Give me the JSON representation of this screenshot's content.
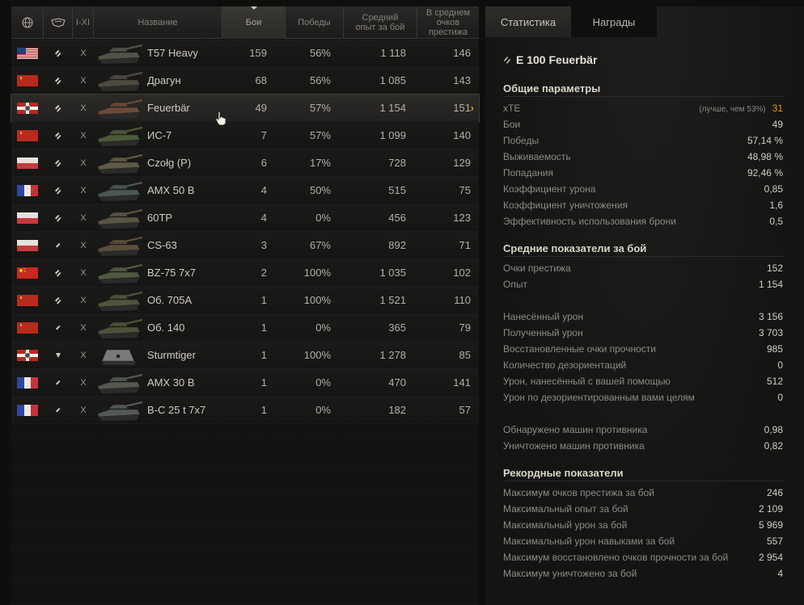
{
  "table": {
    "headers": {
      "nation_icon": "globe-icon",
      "type_icon": "tank-type-icon",
      "tier": "I-XI",
      "name": "Название",
      "battles": "Бои",
      "wins": "Победы",
      "avg_xp": "Средний опыт за бой",
      "avg_prestige": "В среднем очков престижа"
    },
    "rows": [
      {
        "flag": "usa",
        "type": "heavy",
        "tier": "X",
        "name": "T57 Heavy",
        "battles": "159",
        "wins": "56%",
        "xp": "1 118",
        "prestige": "146",
        "color": "#505447"
      },
      {
        "flag": "ussr",
        "type": "heavy",
        "tier": "X",
        "name": "Драгун",
        "battles": "68",
        "wins": "56%",
        "xp": "1 085",
        "prestige": "143",
        "color": "#4f4a40"
      },
      {
        "flag": "germany",
        "type": "heavy",
        "tier": "X",
        "name": "Feuerbär",
        "battles": "49",
        "wins": "57%",
        "xp": "1 154",
        "prestige": "151",
        "color": "#6b4a35",
        "selected": true
      },
      {
        "flag": "ussr",
        "type": "heavy",
        "tier": "X",
        "name": "ИС-7",
        "battles": "7",
        "wins": "57%",
        "xp": "1 099",
        "prestige": "140",
        "color": "#4d5a3a"
      },
      {
        "flag": "poland",
        "type": "heavy",
        "tier": "X",
        "name": "Czołg (P)",
        "battles": "6",
        "wins": "17%",
        "xp": "728",
        "prestige": "129",
        "color": "#5e5a44"
      },
      {
        "flag": "france",
        "type": "heavy",
        "tier": "X",
        "name": "AMX 50 B",
        "battles": "4",
        "wins": "50%",
        "xp": "515",
        "prestige": "75",
        "color": "#4b5752"
      },
      {
        "flag": "poland",
        "type": "heavy",
        "tier": "X",
        "name": "60TP",
        "battles": "4",
        "wins": "0%",
        "xp": "456",
        "prestige": "123",
        "color": "#5a5442"
      },
      {
        "flag": "poland",
        "type": "medium",
        "tier": "X",
        "name": "CS-63",
        "battles": "3",
        "wins": "67%",
        "xp": "892",
        "prestige": "71",
        "color": "#5b4d3c"
      },
      {
        "flag": "china",
        "type": "heavy",
        "tier": "X",
        "name": "BZ-75 7x7",
        "battles": "2",
        "wins": "100%",
        "xp": "1 035",
        "prestige": "102",
        "color": "#4f5a40"
      },
      {
        "flag": "ussr",
        "type": "heavy",
        "tier": "X",
        "name": "Об. 705А",
        "battles": "1",
        "wins": "100%",
        "xp": "1 521",
        "prestige": "110",
        "color": "#4f553c"
      },
      {
        "flag": "ussr",
        "type": "medium",
        "tier": "X",
        "name": "Об. 140",
        "battles": "1",
        "wins": "0%",
        "xp": "365",
        "prestige": "79",
        "color": "#4b5239"
      },
      {
        "flag": "germany",
        "type": "spg",
        "tier": "X",
        "name": "Sturmtiger",
        "battles": "1",
        "wins": "100%",
        "xp": "1 278",
        "prestige": "85",
        "color": "#7a7a78"
      },
      {
        "flag": "france",
        "type": "medium",
        "tier": "X",
        "name": "AMX 30 B",
        "battles": "1",
        "wins": "0%",
        "xp": "470",
        "prestige": "141",
        "color": "#53594f"
      },
      {
        "flag": "france",
        "type": "medium",
        "tier": "X",
        "name": "B-C 25 t 7x7",
        "battles": "1",
        "wins": "0%",
        "xp": "182",
        "prestige": "57",
        "color": "#535a55"
      }
    ]
  },
  "panel": {
    "tabs": [
      "Статистика",
      "Награды"
    ],
    "tank_name": "E 100 Feuerbär",
    "sections": [
      {
        "title": "Общие параметры",
        "rows": [
          {
            "label": "xTE",
            "note": "(лучше, чем 53%)",
            "value": "31",
            "highlight": true
          },
          {
            "label": "Бои",
            "value": "49"
          },
          {
            "label": "Победы",
            "value": "57,14 %"
          },
          {
            "label": "Выживаемость",
            "value": "48,98 %"
          },
          {
            "label": "Попадания",
            "value": "92,46 %"
          },
          {
            "label": "Коэффициент урона",
            "value": "0,85"
          },
          {
            "label": "Коэффициент уничтожения",
            "value": "1,6"
          },
          {
            "label": "Эффективность использования брони",
            "value": "0,5"
          }
        ]
      },
      {
        "title": "Средние показатели за бой",
        "rows": [
          {
            "label": "Очки престижа",
            "value": "152"
          },
          {
            "label": "Опыт",
            "value": "1 154"
          },
          {
            "gap": true
          },
          {
            "label": "Нанесённый урон",
            "value": "3 156"
          },
          {
            "label": "Полученный урон",
            "value": "3 703"
          },
          {
            "label": "Восстановленные очки прочности",
            "value": "985"
          },
          {
            "label": "Количество дезориентаций",
            "value": "0"
          },
          {
            "label": "Урон, нанесённый с вашей помощью",
            "value": "512"
          },
          {
            "label": "Урон по дезориентированным вами целям",
            "value": "0"
          },
          {
            "gap": true
          },
          {
            "label": "Обнаружено машин противника",
            "value": "0,98"
          },
          {
            "label": "Уничтожено машин противника",
            "value": "0,82"
          }
        ]
      },
      {
        "title": "Рекордные показатели",
        "rows": [
          {
            "label": "Максимум очков престижа за бой",
            "value": "246"
          },
          {
            "label": "Максимальный опыт за бой",
            "value": "2 109"
          },
          {
            "label": "Максимальный урон за бой",
            "value": "5 969"
          },
          {
            "label": "Максимальный урон навыками за бой",
            "value": "557"
          },
          {
            "label": "Максимум восстановлено очков прочности за бой",
            "value": "2 954"
          },
          {
            "label": "Максимум уничтожено за бой",
            "value": "4"
          }
        ]
      }
    ]
  }
}
